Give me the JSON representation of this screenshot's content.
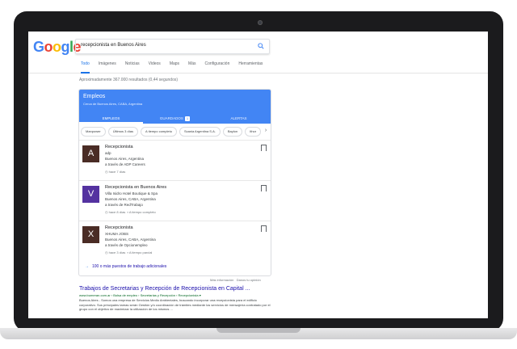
{
  "search": {
    "query": "recepcionista en Buenos Aires",
    "logo": "Google"
  },
  "tabs": [
    "Todo",
    "Imágenes",
    "Noticias",
    "Videos",
    "Maps",
    "Más",
    "Configuración",
    "Herramientas"
  ],
  "stats": "Aproximadamente 367.000 resultados (0,44 segundos)",
  "jobs": {
    "title": "Empleos",
    "subtitle": "Cerca de Buenos Aires, CABA, Argentina",
    "tabs": [
      {
        "label": "EMPLEOS"
      },
      {
        "label": "GUARDADOS",
        "count": "1"
      },
      {
        "label": "ALERTAS"
      }
    ],
    "chips": [
      "Manpower",
      "Últimos 3 días",
      "A tiempo completo",
      "Scania Argentina S.A.",
      "Baylon",
      "Ithor"
    ],
    "items": [
      {
        "letter": "A",
        "color": "#4a2c25",
        "title": "Recepcionista",
        "company": "adp",
        "location": "Buenos Aires, Argentina",
        "via": "a través de ADP Careers",
        "age": "hace 7 días",
        "type": ""
      },
      {
        "letter": "V",
        "color": "#5432a0",
        "title": "Recepcionista en Buenos Aires",
        "company": "Villa Isidro Hotel Boutique & Spa",
        "location": "Buenos Aires, CABA, Argentina",
        "via": "a través de RedTrabajo",
        "age": "hace 8 días",
        "type": "A tiempo completo"
      },
      {
        "letter": "X",
        "color": "#4a2c25",
        "title": "Recepcionista",
        "company": "XHUMA JOBS",
        "location": "Buenos Aires, CABA, Argentina",
        "via": "a través de Opcionempleo",
        "age": "hace 3 días",
        "type": "A tiempo parcial"
      }
    ],
    "more": "100 o más puestos de trabajo adicionales"
  },
  "feedback": {
    "info": "Más información",
    "opinion": "Danos tu opinión"
  },
  "result": {
    "title": "Trabajos de Secretarias y Recepción de Recepcionista en Capital ...",
    "url": "www.bumeran.com.ar › Bolsa de empleo › Secretarias y Recepción › Recepcionista ▾",
    "snippet": "Buenos Aires - Somos una empresa de Servicios Medio Ambientales, buscando incorporar una recepcionista para el edificio corporativo. Sus principales tareas serán Gestión y/o coordinación de trámites mediante los servicios de mensajería contratado por el grupo con el objetivo de maximizar la utilización de los mismos ..."
  },
  "colors": {
    "accent": "#4285f4",
    "link": "#1a0dab"
  }
}
